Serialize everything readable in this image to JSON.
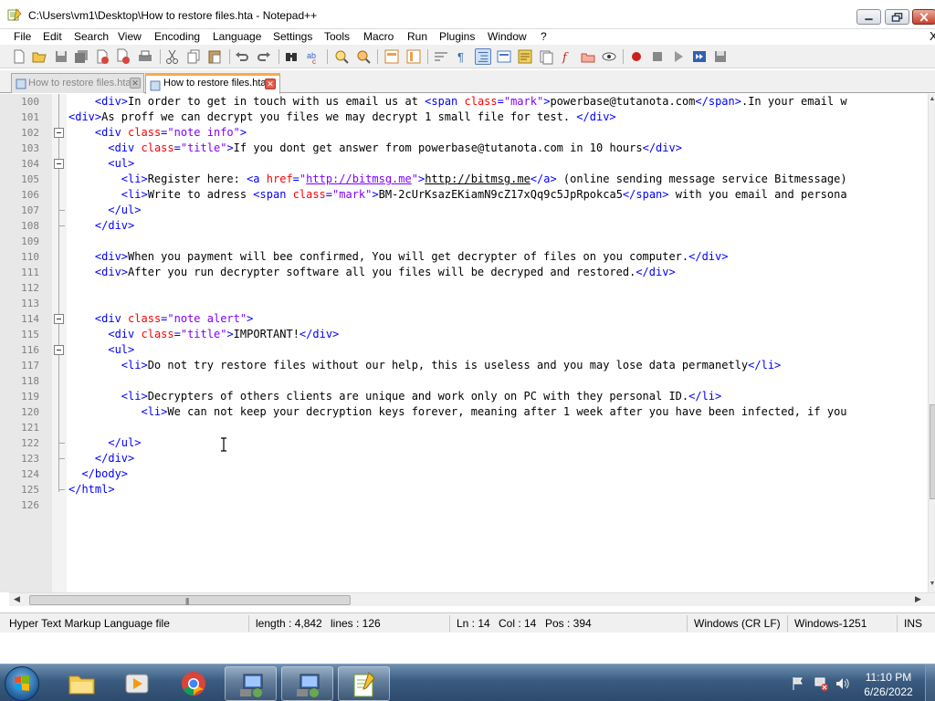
{
  "window": {
    "title": "C:\\Users\\vm1\\Desktop\\How to restore files.hta - Notepad++",
    "minimize_label": "—",
    "maximize_label": "❐",
    "close_label": "✕"
  },
  "menu": {
    "items": [
      "File",
      "Edit",
      "Search",
      "View",
      "Encoding",
      "Language",
      "Settings",
      "Tools",
      "Macro",
      "Run",
      "Plugins",
      "Window",
      "?"
    ],
    "close_x": "X"
  },
  "tabs": [
    {
      "label": "How to restore files.hta",
      "active": false
    },
    {
      "label": "How to restore files.hta",
      "active": true
    }
  ],
  "editor": {
    "lines": [
      {
        "n": "100",
        "html": "&nbsp;&nbsp;&nbsp;&nbsp;<span class=\"t-tag\">&lt;div&gt;</span>In order to get in touch with us email us at <span class=\"t-tag\">&lt;span</span> <span class=\"t-attr\">class</span><span class=\"t-tag\">=</span><span class=\"t-val\">\"mark\"</span><span class=\"t-tag\">&gt;</span>powerbase@tutanota.com<span class=\"t-tag\">&lt;/span&gt;</span>.In your email w"
      },
      {
        "n": "101",
        "html": "<span class=\"t-tag\">&lt;div&gt;</span>As proff we can decrypt you files we may decrypt 1 small file for test. <span class=\"t-tag\">&lt;/div&gt;</span>"
      },
      {
        "n": "102",
        "html": "&nbsp;&nbsp;&nbsp;&nbsp;<span class=\"t-tag\">&lt;div</span> <span class=\"t-attr\">class</span><span class=\"t-tag\">=</span><span class=\"t-val\">\"note info\"</span><span class=\"t-tag\">&gt;</span>"
      },
      {
        "n": "103",
        "html": "&nbsp;&nbsp;&nbsp;&nbsp;&nbsp;&nbsp;<span class=\"t-tag\">&lt;div</span> <span class=\"t-attr\">class</span><span class=\"t-tag\">=</span><span class=\"t-val\">\"title\"</span><span class=\"t-tag\">&gt;</span>If you dont get answer from powerbase@tutanota.com in 10 hours<span class=\"t-tag\">&lt;/div&gt;</span>"
      },
      {
        "n": "104",
        "html": "&nbsp;&nbsp;&nbsp;&nbsp;&nbsp;&nbsp;<span class=\"t-tag\">&lt;ul&gt;</span>"
      },
      {
        "n": "105",
        "html": "&nbsp;&nbsp;&nbsp;&nbsp;&nbsp;&nbsp;&nbsp;&nbsp;<span class=\"t-tag\">&lt;li&gt;</span>Register here: <span class=\"t-tag\">&lt;a</span> <span class=\"t-attr\">href</span><span class=\"t-tag\">=</span><span class=\"t-val\">\"<span style=\"text-decoration:underline\">http://bitmsg.me</span>\"</span><span class=\"t-tag\">&gt;</span><span class=\"t-link\">http://bitmsg.me</span><span class=\"t-tag\">&lt;/a&gt;</span> (online sending message service Bitmessage)"
      },
      {
        "n": "106",
        "html": "&nbsp;&nbsp;&nbsp;&nbsp;&nbsp;&nbsp;&nbsp;&nbsp;<span class=\"t-tag\">&lt;li&gt;</span>Write to adress <span class=\"t-tag\">&lt;span</span> <span class=\"t-attr\">class</span><span class=\"t-tag\">=</span><span class=\"t-val\">\"mark\"</span><span class=\"t-tag\">&gt;</span>BM-2cUrKsazEKiamN9cZ17xQq9c5JpRpokca5<span class=\"t-tag\">&lt;/span&gt;</span> with you email and persona"
      },
      {
        "n": "107",
        "html": "&nbsp;&nbsp;&nbsp;&nbsp;&nbsp;&nbsp;<span class=\"t-tag\">&lt;/ul&gt;</span>"
      },
      {
        "n": "108",
        "html": "&nbsp;&nbsp;&nbsp;&nbsp;<span class=\"t-tag\">&lt;/div&gt;</span>"
      },
      {
        "n": "109",
        "html": ""
      },
      {
        "n": "110",
        "html": "&nbsp;&nbsp;&nbsp;&nbsp;<span class=\"t-tag\">&lt;div&gt;</span>When you payment will bee confirmed, You will get decrypter of files on you computer.<span class=\"t-tag\">&lt;/div&gt;</span>"
      },
      {
        "n": "111",
        "html": "&nbsp;&nbsp;&nbsp;&nbsp;<span class=\"t-tag\">&lt;div&gt;</span>After you run decrypter software all you files will be decryped and restored.<span class=\"t-tag\">&lt;/div&gt;</span>"
      },
      {
        "n": "112",
        "html": ""
      },
      {
        "n": "113",
        "html": ""
      },
      {
        "n": "114",
        "html": "&nbsp;&nbsp;&nbsp;&nbsp;<span class=\"t-tag\">&lt;div</span> <span class=\"t-attr\">class</span><span class=\"t-tag\">=</span><span class=\"t-val\">\"note alert\"</span><span class=\"t-tag\">&gt;</span>"
      },
      {
        "n": "115",
        "html": "&nbsp;&nbsp;&nbsp;&nbsp;&nbsp;&nbsp;<span class=\"t-tag\">&lt;div</span> <span class=\"t-attr\">class</span><span class=\"t-tag\">=</span><span class=\"t-val\">\"title\"</span><span class=\"t-tag\">&gt;</span>IMPORTANT!<span class=\"t-tag\">&lt;/div&gt;</span>"
      },
      {
        "n": "116",
        "html": "&nbsp;&nbsp;&nbsp;&nbsp;&nbsp;&nbsp;<span class=\"t-tag\">&lt;ul&gt;</span>"
      },
      {
        "n": "117",
        "html": "&nbsp;&nbsp;&nbsp;&nbsp;&nbsp;&nbsp;&nbsp;&nbsp;<span class=\"t-tag\">&lt;li&gt;</span>Do not try restore files without our help, this is useless and you may lose data permanetly<span class=\"t-tag\">&lt;/li&gt;</span>"
      },
      {
        "n": "118",
        "html": ""
      },
      {
        "n": "119",
        "html": "&nbsp;&nbsp;&nbsp;&nbsp;&nbsp;&nbsp;&nbsp;&nbsp;<span class=\"t-tag\">&lt;li&gt;</span>Decrypters of others clients are unique and work only on PC with they personal ID.<span class=\"t-tag\">&lt;/li&gt;</span>"
      },
      {
        "n": "120",
        "html": "&nbsp;&nbsp;&nbsp;&nbsp;&nbsp;&nbsp;&nbsp;&nbsp;&nbsp;&nbsp;&nbsp;<span class=\"t-tag\">&lt;li&gt;</span>We can not keep your decryption keys forever, meaning after 1 week after you have been infected, if you"
      },
      {
        "n": "121",
        "html": ""
      },
      {
        "n": "122",
        "html": "&nbsp;&nbsp;&nbsp;&nbsp;&nbsp;&nbsp;<span class=\"t-tag\">&lt;/ul&gt;</span>"
      },
      {
        "n": "123",
        "html": "&nbsp;&nbsp;&nbsp;&nbsp;<span class=\"t-tag\">&lt;/div&gt;</span>"
      },
      {
        "n": "124",
        "html": "&nbsp;&nbsp;<span class=\"t-tag\">&lt;/body&gt;</span>"
      },
      {
        "n": "125",
        "html": "<span class=\"t-tag\">&lt;/html&gt;</span>"
      },
      {
        "n": "126",
        "html": ""
      }
    ]
  },
  "statusbar": {
    "file_type": "Hyper Text Markup Language file",
    "length": "length : 4,842",
    "lines": "lines : 126",
    "ln": "Ln : 14",
    "col": "Col : 14",
    "pos": "Pos : 394",
    "eol": "Windows (CR LF)",
    "encoding": "Windows-1251",
    "mode": "INS"
  },
  "taskbar": {
    "time": "11:10 PM",
    "date": "6/26/2022"
  },
  "colors": {
    "tag": "#0000ff",
    "attr": "#ff0000",
    "value": "#8000ff",
    "active_tab_accent": "#f9a94b"
  }
}
